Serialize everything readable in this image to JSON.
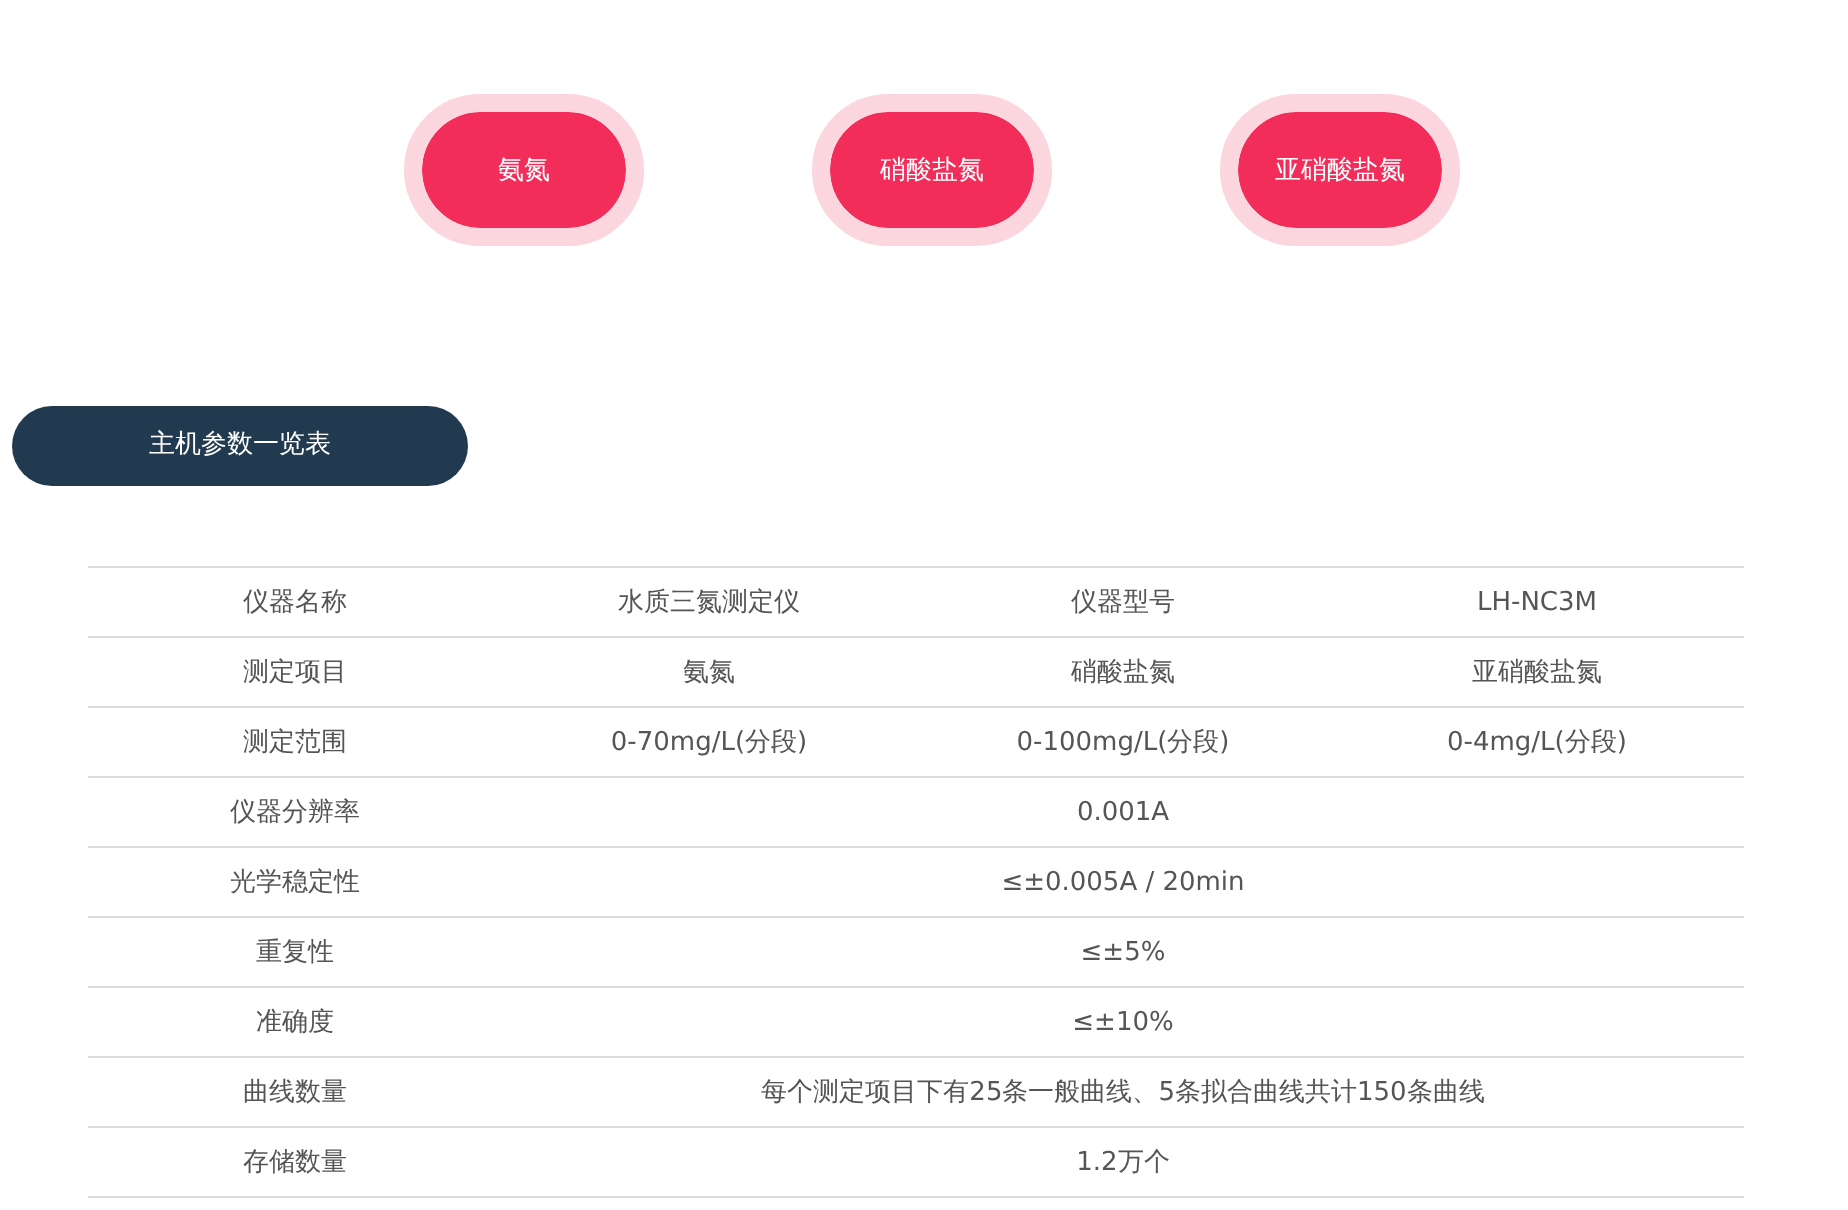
{
  "tabs": [
    {
      "label": "氨氮"
    },
    {
      "label": "硝酸盐氮"
    },
    {
      "label": "亚硝酸盐氮"
    }
  ],
  "section_title": "主机参数一览表",
  "table": {
    "rows": [
      {
        "label": "仪器名称",
        "cells": [
          {
            "text": "水质三氮测定仪"
          },
          {
            "text": "仪器型号"
          },
          {
            "text": "LH-NC3M"
          }
        ]
      },
      {
        "label": "测定项目",
        "cells": [
          {
            "text": "氨氮"
          },
          {
            "text": "硝酸盐氮"
          },
          {
            "text": "亚硝酸盐氮"
          }
        ]
      },
      {
        "label": "测定范围",
        "cells": [
          {
            "text": "0-70mg/L(分段)"
          },
          {
            "text": "0-100mg/L(分段)"
          },
          {
            "text": "0-4mg/L(分段)"
          }
        ]
      },
      {
        "label": "仪器分辨率",
        "cells": [
          {
            "text": "0.001A",
            "colspan": 3
          }
        ]
      },
      {
        "label": "光学稳定性",
        "cells": [
          {
            "text": "≤±0.005A / 20min",
            "colspan": 3
          }
        ]
      },
      {
        "label": "重复性",
        "cells": [
          {
            "text": "≤±5%",
            "colspan": 3
          }
        ]
      },
      {
        "label": "准确度",
        "cells": [
          {
            "text": "≤±10%",
            "colspan": 3
          }
        ]
      },
      {
        "label": "曲线数量",
        "cells": [
          {
            "text": "每个测定项目下有25条一般曲线、5条拟合曲线共计150条曲线",
            "colspan": 3
          }
        ]
      },
      {
        "label": "存储数量",
        "cells": [
          {
            "text": "1.2万个",
            "colspan": 3
          }
        ]
      }
    ]
  }
}
